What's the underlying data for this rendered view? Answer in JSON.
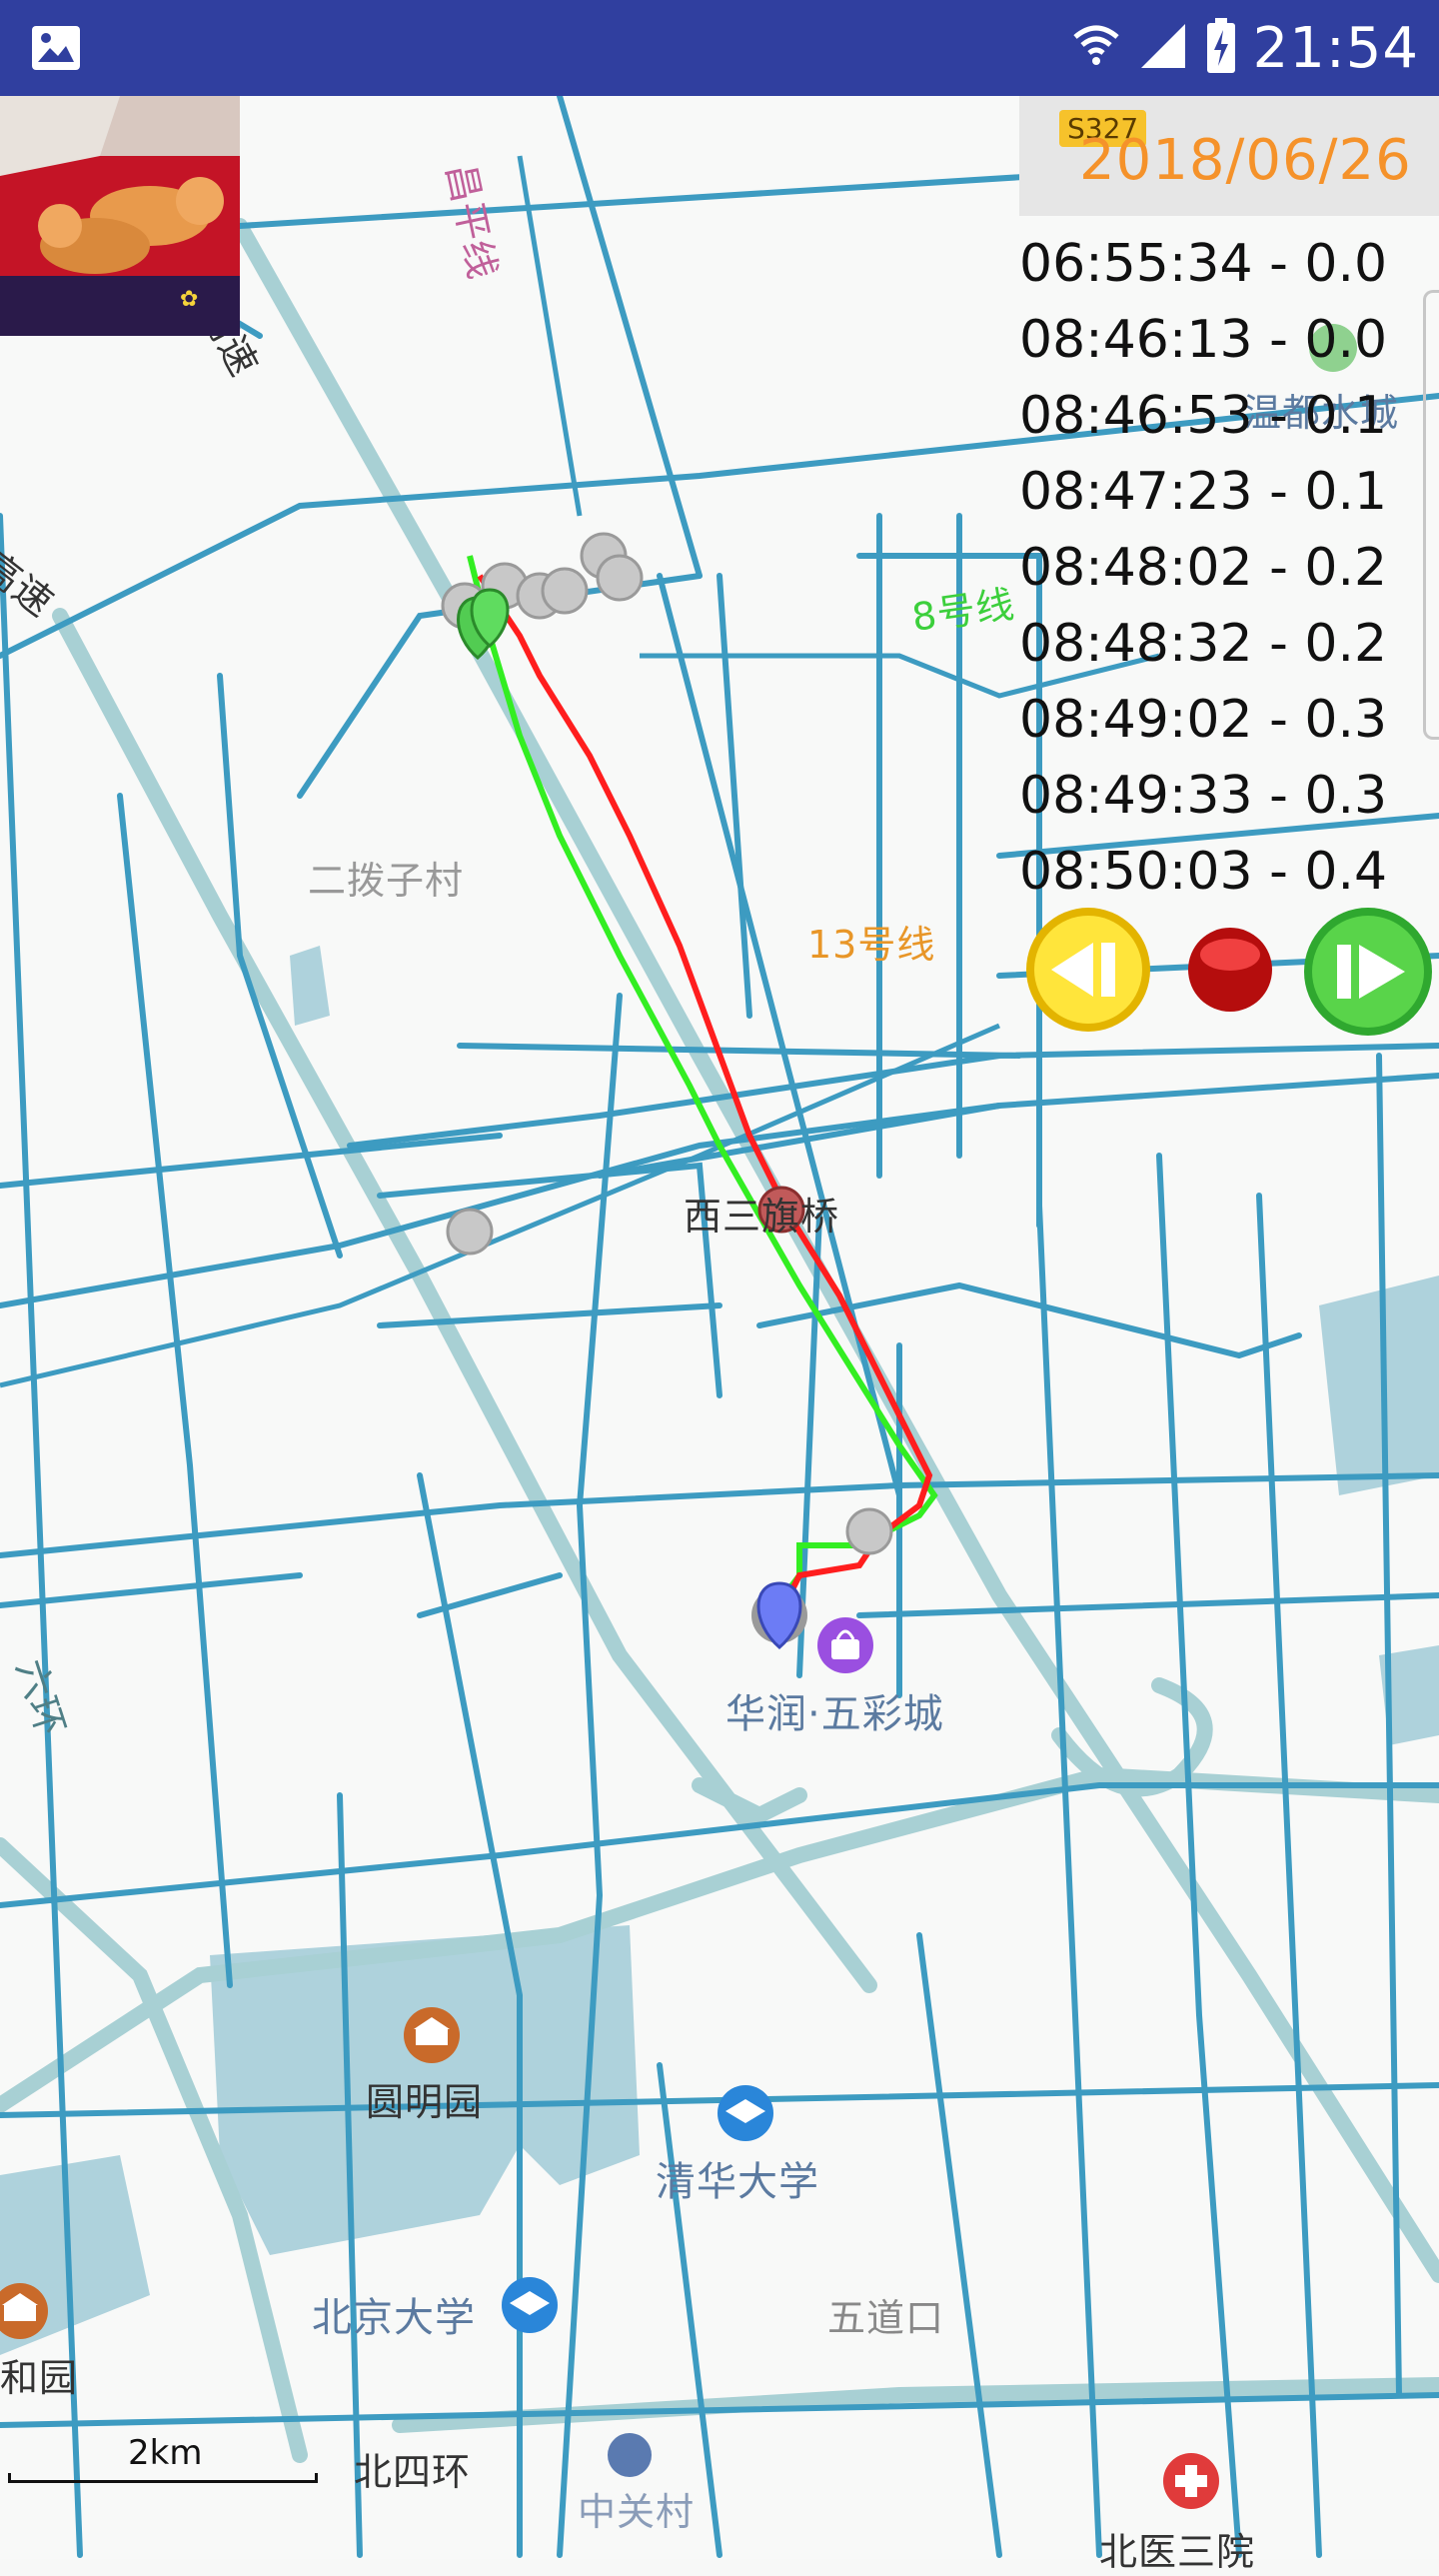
{
  "status_bar": {
    "time": "21:54",
    "icons": [
      "image-icon",
      "wifi-icon",
      "signal-icon",
      "battery-charging-icon"
    ]
  },
  "header": {
    "date": "2018/06/26",
    "road_tag": "S327"
  },
  "track_log": [
    "06:55:34 - 0.0",
    "08:46:13 - 0.0",
    "08:46:53 - 0.1",
    "08:47:23 - 0.1",
    "08:48:02 - 0.2",
    "08:48:32 - 0.2",
    "08:49:02 - 0.3",
    "08:49:33 - 0.3",
    "08:50:03 - 0.4"
  ],
  "controls": {
    "rewind_icon": "rewind-icon",
    "record_icon": "record-icon",
    "forward_icon": "forward-icon"
  },
  "map_labels": {
    "changping_line": "昌平线",
    "expressway_top": "高速",
    "expressway_left": "高速",
    "wenquan": "温都水城",
    "line8": "8号线",
    "erbozi": "二拨子村",
    "line13": "13号线",
    "xisanqi": "西三旗桥",
    "huarun": "华润·五彩城",
    "ring6": "六环",
    "yuanmingyuan": "圆明园",
    "tsinghua": "清华大学",
    "pku": "北京大学",
    "wudaokou": "五道口",
    "yiheyuan": "和园",
    "north4": "北四环",
    "zhongguancun": "中关村",
    "beiyi": "北医三院"
  },
  "scale": {
    "label": "2km"
  },
  "colors": {
    "status_bar": "#303f9f",
    "road": "#3d9bc1",
    "highway": "#a8d0d4",
    "track_red": "#ff1e1e",
    "track_green": "#33ee22",
    "date_text": "#f5922a"
  }
}
